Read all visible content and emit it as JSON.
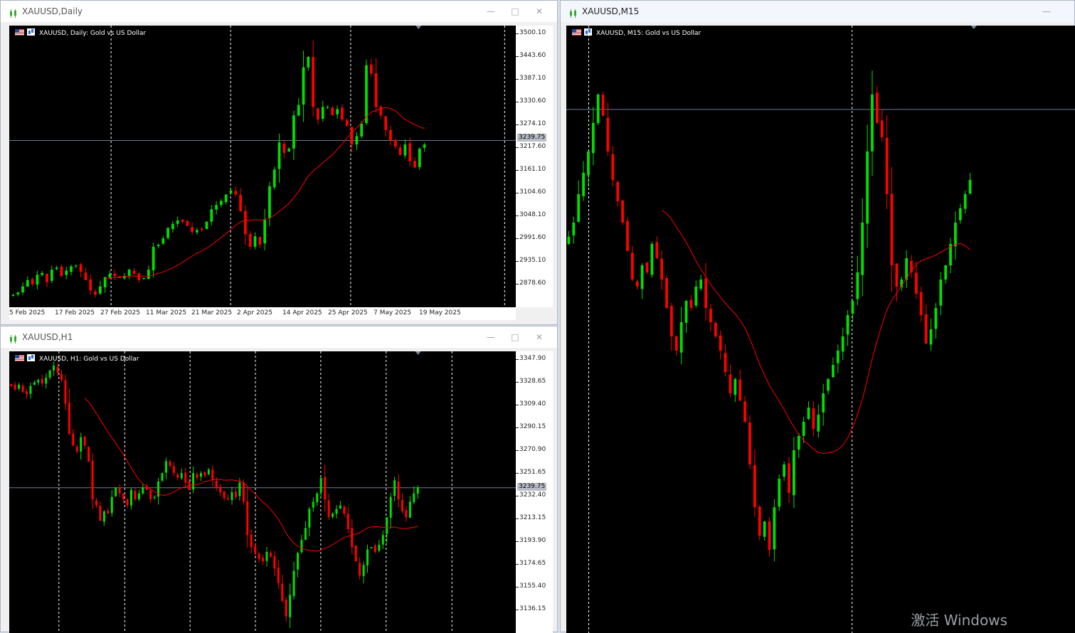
{
  "colors": {
    "bull": "#00e000",
    "bear": "#ff0000",
    "ma": "#ff0000",
    "grid": "#ffffff",
    "priceLine": "#6b7a94",
    "background": "#000000"
  },
  "windows": [
    {
      "title": "XAUUSD,Daily",
      "header": "XAUUSD, Daily:  Gold vs US Dollar",
      "y_ticks": [
        "3500.10",
        "3443.60",
        "3387.10",
        "3330.60",
        "3274.10",
        "3217.60",
        "3161.10",
        "3104.60",
        "3048.10",
        "2991.60",
        "2935.10",
        "2878.60"
      ],
      "x_ticks": [
        "5 Feb 2025",
        "17 Feb 2025",
        "27 Feb 2025",
        "11 Mar 2025",
        "21 Mar 2025",
        "2 Apr 2025",
        "14 Apr 2025",
        "25 Apr 2025",
        "7 May 2025",
        "19 May 2025"
      ],
      "price_label": "3239.75"
    },
    {
      "title": "XAUUSD,H1",
      "header": "XAUUSD, H1:  Gold vs US Dollar",
      "y_ticks": [
        "3347.90",
        "3328.65",
        "3309.40",
        "3290.15",
        "3270.90",
        "3251.65",
        "3232.40",
        "3213.15",
        "3193.90",
        "3174.65",
        "3155.40",
        "3136.15"
      ],
      "x_ticks": [],
      "price_label": "3239.75"
    },
    {
      "title": "XAUUSD,M15",
      "header": "XAUUSD, M15:  Gold vs US Dollar",
      "y_ticks": [],
      "x_ticks": [],
      "price_label": ""
    }
  ],
  "chart_data": [
    {
      "type": "candlestick",
      "title": "XAUUSD, Daily:  Gold vs US Dollar",
      "ylim": [
        2840,
        3515
      ],
      "current_price": 3239.75,
      "moving_average": true,
      "x_ticks": [
        "5 Feb 2025",
        "17 Feb 2025",
        "27 Feb 2025",
        "11 Mar 2025",
        "21 Mar 2025",
        "2 Apr 2025",
        "14 Apr 2025",
        "25 Apr 2025",
        "7 May 2025",
        "19 May 2025"
      ],
      "closes": [
        2870,
        2875,
        2890,
        2905,
        2895,
        2918,
        2922,
        2900,
        2930,
        2935,
        2915,
        2928,
        2938,
        2940,
        2925,
        2905,
        2880,
        2870,
        2890,
        2912,
        2920,
        2915,
        2910,
        2915,
        2930,
        2920,
        2905,
        2910,
        2930,
        2985,
        2990,
        3005,
        3030,
        3040,
        3048,
        3045,
        3035,
        3020,
        3025,
        3025,
        3045,
        3075,
        3085,
        3095,
        3110,
        3120,
        3110,
        3070,
        3015,
        2985,
        3010,
        2990,
        3050,
        3130,
        3170,
        3235,
        3210,
        3220,
        3300,
        3325,
        3415,
        3440,
        3320,
        3290,
        3320,
        3320,
        3300,
        3315,
        3290,
        3275,
        3230,
        3250,
        3280,
        3420,
        3400,
        3320,
        3300,
        3265,
        3240,
        3225,
        3205,
        3230,
        3190,
        3175,
        3220,
        3230
      ]
    },
    {
      "type": "candlestick",
      "title": "XAUUSD, H1:  Gold vs US Dollar",
      "ylim": [
        3118,
        3354
      ],
      "current_price": 3239.75,
      "moving_average": true,
      "closes": [
        3325,
        3322,
        3326,
        3320,
        3318,
        3325,
        3328,
        3330,
        3327,
        3332,
        3338,
        3342,
        3336,
        3330,
        3310,
        3285,
        3275,
        3270,
        3282,
        3275,
        3262,
        3230,
        3225,
        3212,
        3220,
        3218,
        3232,
        3240,
        3235,
        3230,
        3225,
        3238,
        3230,
        3235,
        3240,
        3238,
        3230,
        3232,
        3245,
        3252,
        3262,
        3258,
        3252,
        3248,
        3252,
        3244,
        3238,
        3252,
        3248,
        3252,
        3250,
        3255,
        3246,
        3240,
        3236,
        3231,
        3230,
        3236,
        3232,
        3244,
        3228,
        3200,
        3190,
        3185,
        3180,
        3178,
        3186,
        3182,
        3172,
        3160,
        3145,
        3132,
        3150,
        3170,
        3185,
        3196,
        3206,
        3222,
        3228,
        3235,
        3248,
        3230,
        3215,
        3218,
        3222,
        3225,
        3218,
        3205,
        3190,
        3178,
        3166,
        3175,
        3188,
        3190,
        3186,
        3192,
        3200,
        3215,
        3232,
        3246,
        3230,
        3220,
        3215,
        3228,
        3235,
        3240
      ]
    },
    {
      "type": "candlestick",
      "title": "XAUUSD, M15:  Gold vs US Dollar",
      "closes": [
        3200,
        3210,
        3230,
        3245,
        3260,
        3280,
        3300,
        3285,
        3260,
        3240,
        3225,
        3210,
        3190,
        3170,
        3165,
        3180,
        3175,
        3195,
        3185,
        3170,
        3150,
        3130,
        3120,
        3140,
        3155,
        3150,
        3165,
        3170,
        3150,
        3140,
        3130,
        3120,
        3105,
        3090,
        3100,
        3085,
        3070,
        3040,
        3010,
        2990,
        3000,
        2980,
        3010,
        3030,
        3040,
        3020,
        3050,
        3060,
        3070,
        3080,
        3065,
        3075,
        3090,
        3100,
        3110,
        3120,
        3130,
        3145,
        3155,
        3175,
        3210,
        3260,
        3300,
        3280,
        3270,
        3230,
        3180,
        3165,
        3170,
        3185,
        3175,
        3160,
        3145,
        3125,
        3135,
        3150,
        3170,
        3180,
        3195,
        3210,
        3220,
        3230,
        3240
      ]
    }
  ],
  "watermark": "激活 Windows"
}
